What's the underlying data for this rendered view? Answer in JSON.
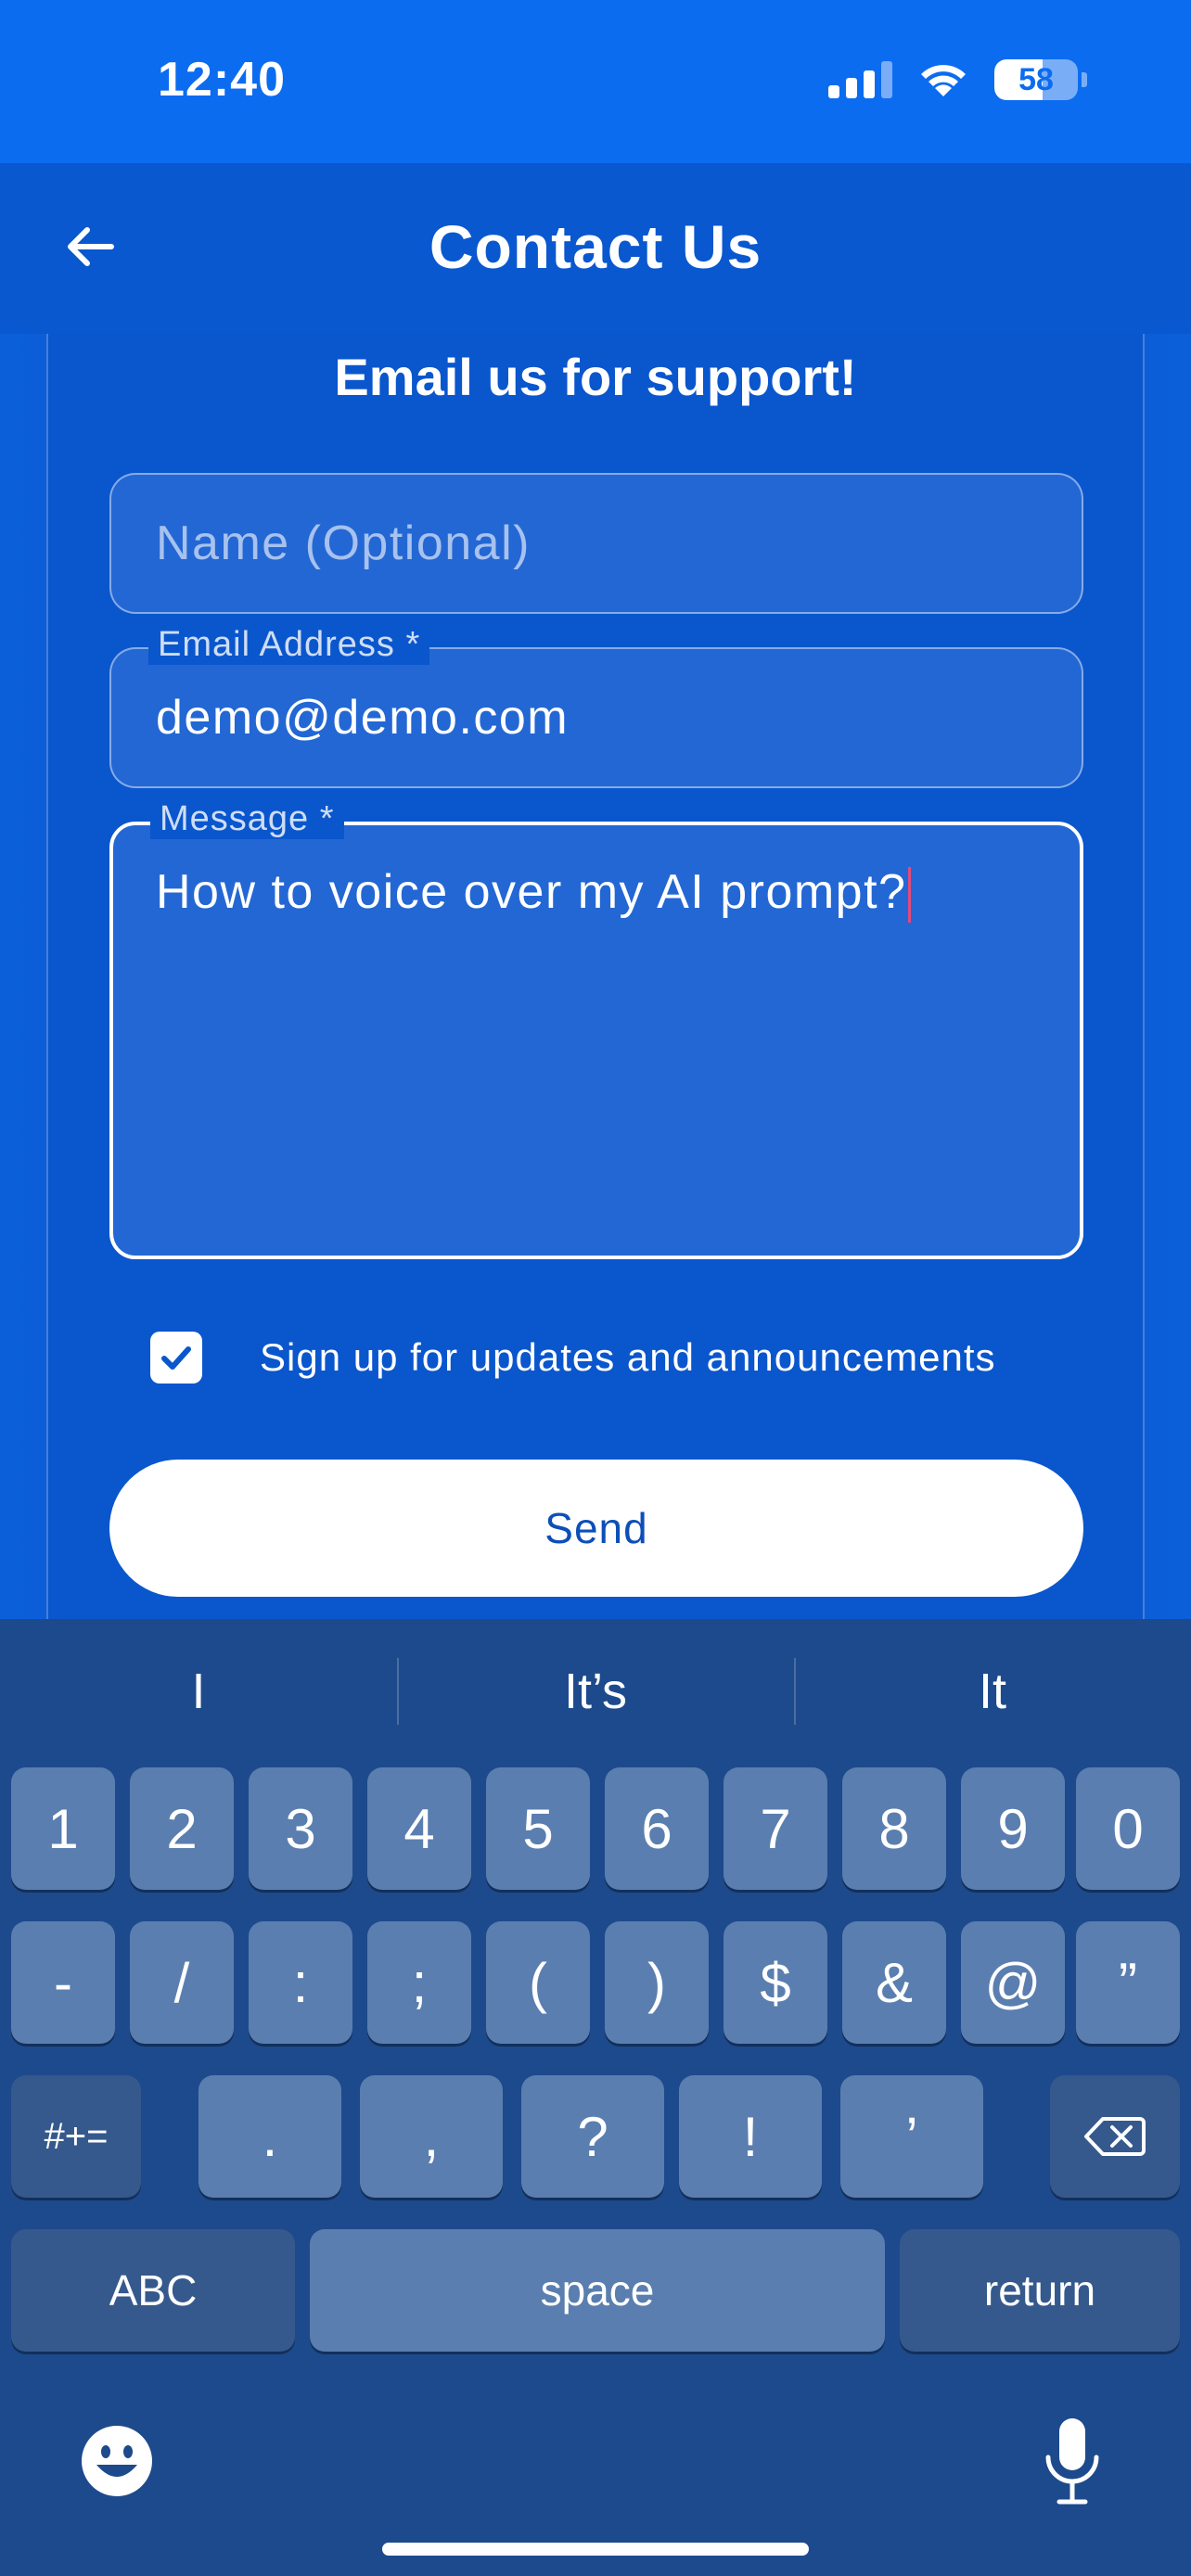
{
  "status_bar": {
    "time": "12:40",
    "battery": "58",
    "battery_level_percent": 58
  },
  "nav": {
    "title": "Contact Us"
  },
  "form": {
    "heading": "Email us for support!",
    "name_placeholder": "Name (Optional)",
    "email_label": "Email Address *",
    "email_value": "demo@demo.com",
    "message_label": "Message *",
    "message_value": "How to voice over my AI prompt?",
    "signup_checked": true,
    "signup_label": "Sign up for updates and announcements",
    "send_label": "Send"
  },
  "keyboard": {
    "suggestions": [
      "I",
      "It’s",
      "It"
    ],
    "row1": [
      "1",
      "2",
      "3",
      "4",
      "5",
      "6",
      "7",
      "8",
      "9",
      "0"
    ],
    "row2": [
      "-",
      "/",
      ":",
      ";",
      "(",
      ")",
      "$",
      "&",
      "@",
      "”"
    ],
    "row3": {
      "mode": "#+=",
      "keys": [
        ".",
        ",",
        "?",
        "!",
        "’"
      ]
    },
    "row4": {
      "abc": "ABC",
      "space": "space",
      "return": "return"
    }
  },
  "colors": {
    "status_bar": "#0b6cf0",
    "nav_bar": "#0958cf",
    "background": "#0a56cd",
    "field": "#2367d4",
    "keyboard": "#1d4a8c",
    "key": "#5a7eaf",
    "key_dark": "#35598d",
    "button_text": "#0d4fb8"
  },
  "icons": [
    "back-arrow-icon",
    "signal-icon",
    "wifi-icon",
    "battery-icon",
    "checkmark-icon",
    "backspace-icon",
    "emoji-icon",
    "microphone-icon"
  ]
}
